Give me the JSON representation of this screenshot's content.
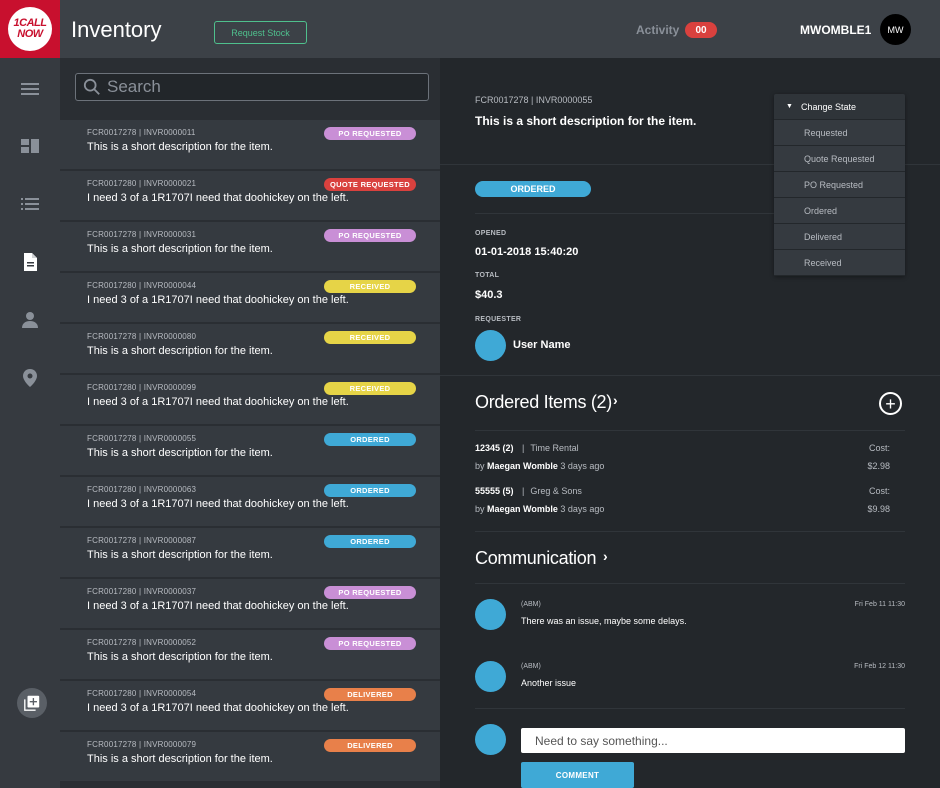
{
  "header": {
    "logo_text": "1CALL NOW",
    "title": "Inventory",
    "request_stock_label": "Request Stock",
    "activity_label": "Activity",
    "activity_count": "00",
    "username": "MWOMBLE1",
    "avatar_initials": "MW"
  },
  "colors": {
    "po_requested": "#c98fd6",
    "quote_requested": "#d9413e",
    "received": "#e6d447",
    "ordered": "#3fa9d6",
    "delivered": "#e8804a"
  },
  "search": {
    "placeholder": "Search"
  },
  "list": [
    {
      "id": "FCR0017278 | INVR0000011",
      "desc": "This is a short description for the item.",
      "status": "PO REQUESTED",
      "status_key": "po_requested"
    },
    {
      "id": "FCR0017280 | INVR0000021",
      "desc": "I need 3 of a 1R1707I need that doohickey on the left.",
      "status": "QUOTE REQUESTED",
      "status_key": "quote_requested"
    },
    {
      "id": "FCR0017278 | INVR0000031",
      "desc": "This is a short description for the item.",
      "status": "PO REQUESTED",
      "status_key": "po_requested"
    },
    {
      "id": "FCR0017280 | INVR0000044",
      "desc": "I need 3 of a 1R1707I need that doohickey on the left.",
      "status": "RECEIVED",
      "status_key": "received"
    },
    {
      "id": "FCR0017278 | INVR0000080",
      "desc": "This is a short description for the item.",
      "status": "RECEIVED",
      "status_key": "received"
    },
    {
      "id": "FCR0017280 | INVR0000099",
      "desc": "I need 3 of a 1R1707I need that doohickey on the left.",
      "status": "RECEIVED",
      "status_key": "received"
    },
    {
      "id": "FCR0017278 | INVR0000055",
      "desc": "This is a short description for the item.",
      "status": "ORDERED",
      "status_key": "ordered"
    },
    {
      "id": "FCR0017280 | INVR0000063",
      "desc": "I need 3 of a 1R1707I need that doohickey on the left.",
      "status": "ORDERED",
      "status_key": "ordered"
    },
    {
      "id": "FCR0017278 | INVR0000087",
      "desc": "This is a short description for the item.",
      "status": "ORDERED",
      "status_key": "ordered"
    },
    {
      "id": "FCR0017280 | INVR0000037",
      "desc": "I need 3 of a 1R1707I need that doohickey on the left.",
      "status": "PO REQUESTED",
      "status_key": "po_requested"
    },
    {
      "id": "FCR0017278 | INVR0000052",
      "desc": "This is a short description for the item.",
      "status": "PO REQUESTED",
      "status_key": "po_requested"
    },
    {
      "id": "FCR0017280 | INVR0000054",
      "desc": "I need 3 of a 1R1707I need that doohickey on the left.",
      "status": "DELIVERED",
      "status_key": "delivered"
    },
    {
      "id": "FCR0017278 | INVR0000079",
      "desc": "This is a short description for the item.",
      "status": "DELIVERED",
      "status_key": "delivered"
    }
  ],
  "detail": {
    "id": "FCR0017278 | INVR0000055",
    "desc": "This is a short description for the item.",
    "state": "ORDERED",
    "opened_label": "OPENED",
    "opened_value": "01-01-2018 15:40:20",
    "total_label": "TOTAL",
    "total_value": "$40.3",
    "requester_label": "REQUESTER",
    "requester_name": "User Name",
    "ordered_items_title": "Ordered Items (2)",
    "items": [
      {
        "qty": "12345 (2)",
        "sep": "|",
        "vendor": "Time Rental",
        "by": "by",
        "person": "Maegan Womble",
        "when": "3 days ago",
        "cost_label": "Cost:",
        "cost": "$2.98"
      },
      {
        "qty": "55555 (5)",
        "sep": "|",
        "vendor": "Greg & Sons",
        "by": "by",
        "person": "Maegan Womble",
        "when": "3 days ago",
        "cost_label": "Cost:",
        "cost": "$9.98"
      }
    ],
    "communication_title": "Communication",
    "messages": [
      {
        "who": "(ABM)",
        "msg": "There was an issue, maybe some delays.",
        "date": "Fri Feb 11 11:30"
      },
      {
        "who": "(ABM)",
        "msg": "Another issue",
        "date": "Fri Feb 12 11:30"
      }
    ],
    "input_placeholder": "Need to say something...",
    "comment_label": "COMMENT"
  },
  "change_state": {
    "label": "Change State",
    "options": [
      "Requested",
      "Quote Requested",
      "PO Requested",
      "Ordered",
      "Delivered",
      "Received"
    ]
  }
}
